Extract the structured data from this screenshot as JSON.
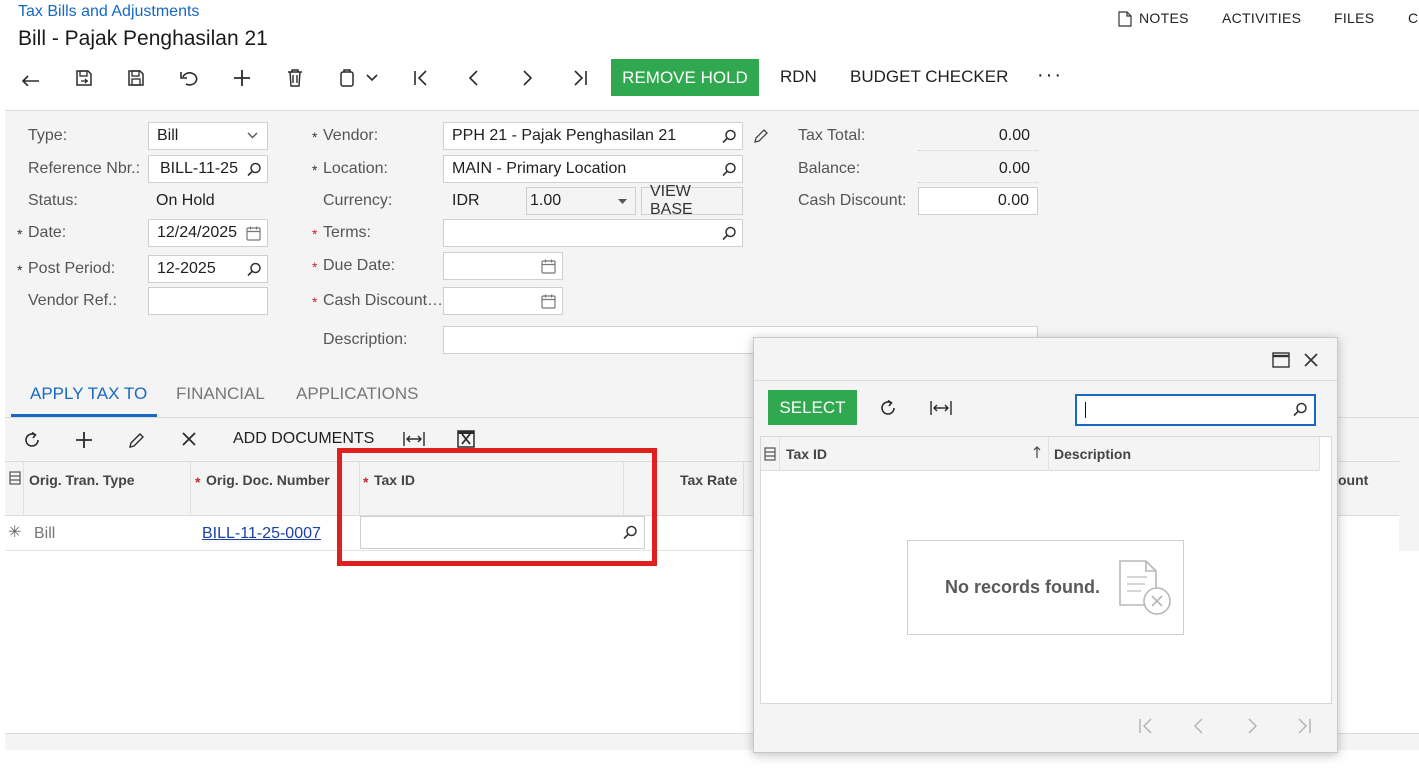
{
  "breadcrumb": "Tax Bills and Adjustments",
  "page_title": "Bill - Pajak Penghasilan 21",
  "top_links": [
    "NOTES",
    "ACTIVITIES",
    "FILES",
    "C"
  ],
  "toolbar": {
    "remove_hold": "REMOVE HOLD",
    "rdn": "RDN",
    "budget_checker": "BUDGET CHECKER",
    "more": "···"
  },
  "form": {
    "type_label": "Type:",
    "type_value": "Bill",
    "ref_label": "Reference Nbr.:",
    "ref_value": "BILL-11-25",
    "status_label": "Status:",
    "status_value": "On Hold",
    "date_label": "Date:",
    "date_value": "12/24/2025",
    "post_period_label": "Post Period:",
    "post_period_value": "12-2025",
    "vendor_ref_label": "Vendor Ref.:",
    "vendor_ref_value": "",
    "vendor_label": "Vendor:",
    "vendor_value": "PPH 21 - Pajak Penghasilan 21",
    "location_label": "Location:",
    "location_value": "MAIN - Primary Location",
    "currency_label": "Currency:",
    "currency_value": "IDR",
    "rate_value": "1.00",
    "view_base": "VIEW BASE",
    "terms_label": "Terms:",
    "terms_value": "",
    "due_date_label": "Due Date:",
    "cash_discount_date_label": "Cash Discount…",
    "description_label": "Description:",
    "tax_total_label": "Tax Total:",
    "tax_total_value": "0.00",
    "balance_label": "Balance:",
    "balance_value": "0.00",
    "cash_discount_label": "Cash Discount:",
    "cash_discount_value": "0.00"
  },
  "tabs": [
    "APPLY TAX TO",
    "FINANCIAL",
    "APPLICATIONS"
  ],
  "grid_toolbar": {
    "add_documents": "ADD DOCUMENTS"
  },
  "grid": {
    "headers": [
      "Orig. Tran. Type",
      "Orig. Doc. Number",
      "Tax ID",
      "Tax Rate",
      "ount"
    ],
    "row": {
      "type": "Bill",
      "doc_number": "BILL-11-25-0007",
      "tax_id": ""
    }
  },
  "dialog": {
    "select": "SELECT",
    "search_value": "",
    "headers": [
      "Tax ID",
      "Description"
    ],
    "empty_message": "No records found."
  },
  "colors": {
    "accent": "#1769c4",
    "green": "#2fa84f",
    "highlight": "#e0201e"
  }
}
